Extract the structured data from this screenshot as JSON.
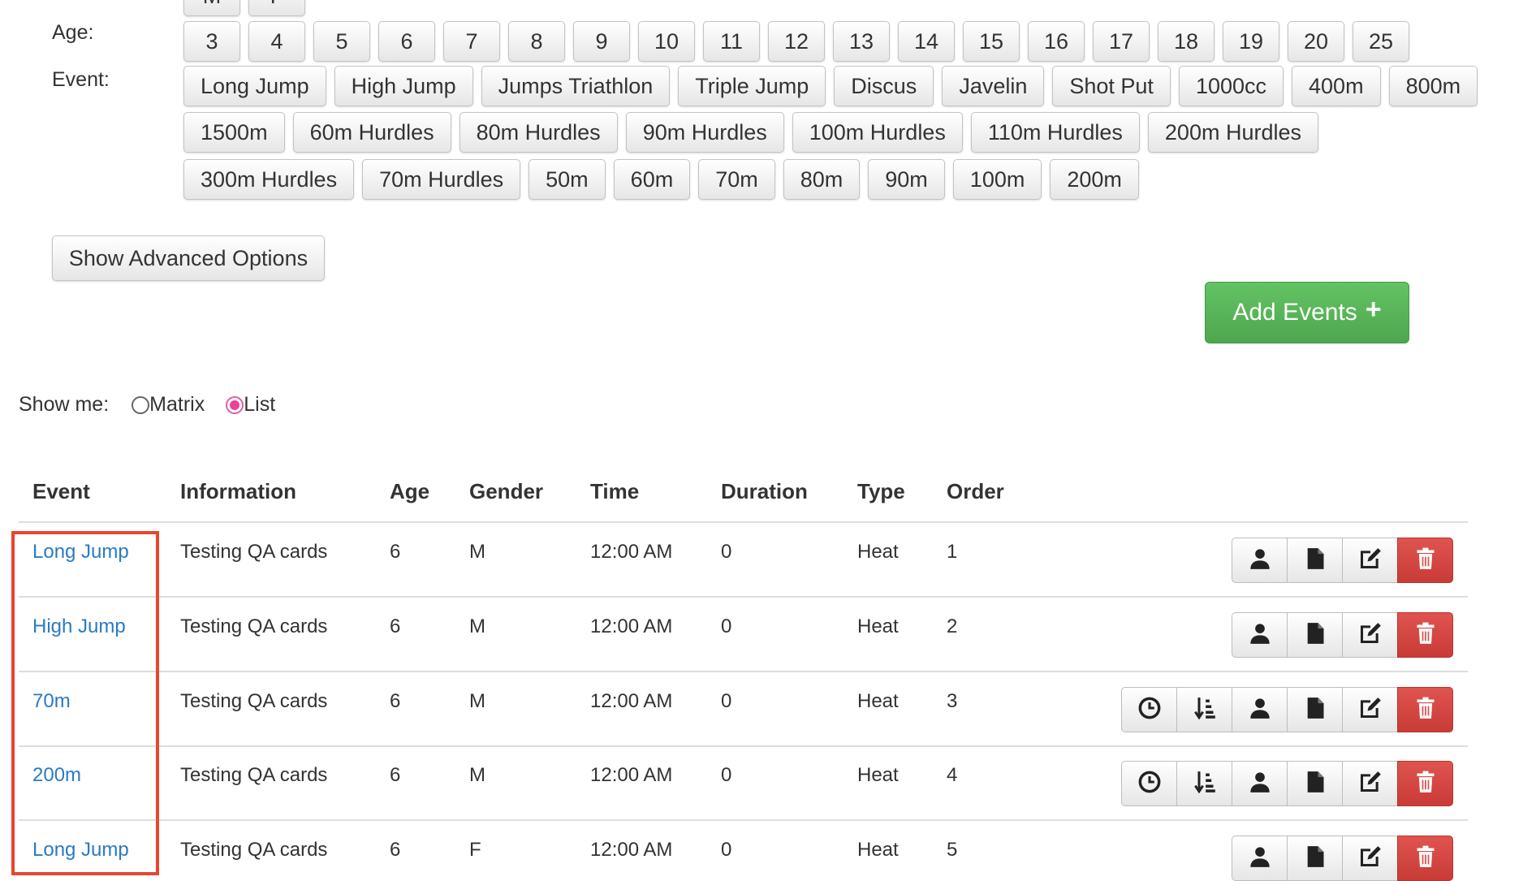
{
  "filters": {
    "gender_label": "M",
    "gender_label_2": "F",
    "age_label": "Age:",
    "ages": [
      "3",
      "4",
      "5",
      "6",
      "7",
      "8",
      "9",
      "10",
      "11",
      "12",
      "13",
      "14",
      "15",
      "16",
      "17",
      "18",
      "19",
      "20",
      "25"
    ],
    "event_label": "Event:",
    "event_rows": [
      [
        "Long Jump",
        "High Jump",
        "Jumps Triathlon",
        "Triple Jump",
        "Discus",
        "Javelin",
        "Shot Put",
        "1000cc",
        "400m",
        "800m"
      ],
      [
        "1500m",
        "60m Hurdles",
        "80m Hurdles",
        "90m Hurdles",
        "100m Hurdles",
        "110m Hurdles",
        "200m Hurdles"
      ],
      [
        "300m Hurdles",
        "70m Hurdles",
        "50m",
        "60m",
        "70m",
        "80m",
        "90m",
        "100m",
        "200m"
      ]
    ]
  },
  "advanced_button": "Show Advanced Options",
  "add_button": "Add Events",
  "view": {
    "label": "Show me:",
    "options": [
      "Matrix",
      "List"
    ],
    "selected": "List"
  },
  "table": {
    "headers": [
      "Event",
      "Information",
      "Age",
      "Gender",
      "Time",
      "Duration",
      "Type",
      "Order"
    ],
    "rows": [
      {
        "event": "Long Jump",
        "info": "Testing QA cards",
        "age": "6",
        "gender": "M",
        "time": "12:00 AM",
        "duration": "0",
        "type": "Heat",
        "order": "1",
        "actions": [
          "person-icon",
          "file-icon",
          "edit-icon",
          "trash-icon"
        ]
      },
      {
        "event": "High Jump",
        "info": "Testing QA cards",
        "age": "6",
        "gender": "M",
        "time": "12:00 AM",
        "duration": "0",
        "type": "Heat",
        "order": "2",
        "actions": [
          "person-icon",
          "file-icon",
          "edit-icon",
          "trash-icon"
        ]
      },
      {
        "event": "70m",
        "info": "Testing QA cards",
        "age": "6",
        "gender": "M",
        "time": "12:00 AM",
        "duration": "0",
        "type": "Heat",
        "order": "3",
        "actions": [
          "clock-icon",
          "sort-icon",
          "person-icon",
          "file-icon",
          "edit-icon",
          "trash-icon"
        ]
      },
      {
        "event": "200m",
        "info": "Testing QA cards",
        "age": "6",
        "gender": "M",
        "time": "12:00 AM",
        "duration": "0",
        "type": "Heat",
        "order": "4",
        "actions": [
          "clock-icon",
          "sort-icon",
          "person-icon",
          "file-icon",
          "edit-icon",
          "trash-icon"
        ]
      },
      {
        "event": "Long Jump",
        "info": "Testing QA cards",
        "age": "6",
        "gender": "F",
        "time": "12:00 AM",
        "duration": "0",
        "type": "Heat",
        "order": "5",
        "actions": [
          "person-icon",
          "file-icon",
          "edit-icon",
          "trash-icon"
        ]
      }
    ]
  },
  "colors": {
    "link": "#2a7ac5",
    "success": "#5cb85c",
    "danger": "#d9534f",
    "highlight": "#e8462d",
    "radio_selected": "#e8449a"
  }
}
